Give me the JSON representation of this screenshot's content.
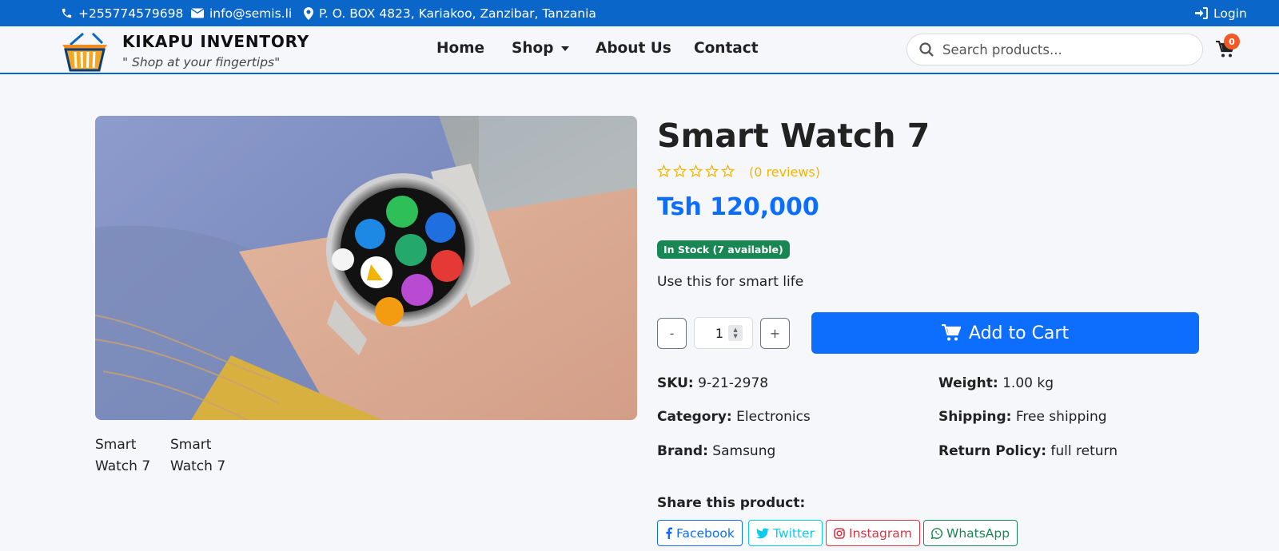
{
  "topbar": {
    "phone": "+255774579698",
    "email": "info@semis.li",
    "address": "P. O. BOX 4823, Kariakoo, Zanzibar, Tanzania",
    "login": "Login"
  },
  "brand": {
    "name": "KIKAPU INVENTORY",
    "tagline": "\" Shop at your fingertips\""
  },
  "nav": {
    "home": "Home",
    "shop": "Shop",
    "about": "About Us",
    "contact": "Contact"
  },
  "search": {
    "placeholder": "Search products..."
  },
  "cart": {
    "count": "0"
  },
  "product": {
    "title": "Smart Watch 7",
    "rating": 0,
    "rating_max": 5,
    "reviews": "(0 reviews)",
    "price": "Tsh 120,000",
    "stock": "In Stock (7 available)",
    "description": "Use this for smart life",
    "quantity": "1",
    "decrement": "-",
    "increment": "+",
    "add_to_cart": "Add to Cart",
    "thumbnails": [
      "Smart Watch 7",
      "Smart Watch 7"
    ]
  },
  "specs": {
    "sku_label": "SKU:",
    "sku": "9-21-2978",
    "weight_label": "Weight:",
    "weight": "1.00 kg",
    "category_label": "Category:",
    "category": "Electronics",
    "shipping_label": "Shipping:",
    "shipping": "Free shipping",
    "brand_label": "Brand:",
    "brand": "Samsung",
    "return_label": "Return Policy:",
    "return": "full return"
  },
  "share": {
    "heading": "Share this product:",
    "facebook": "Facebook",
    "twitter": "Twitter",
    "instagram": "Instagram",
    "whatsapp": "WhatsApp"
  },
  "colors": {
    "primary": "#0d6efd",
    "topbar": "#0a66c8",
    "success": "#198754",
    "star": "#f2b400",
    "badge": "#f15a24",
    "facebook": "#0d6efd",
    "twitter": "#0dcaf0",
    "instagram": "#dc3545",
    "whatsapp": "#198754"
  }
}
